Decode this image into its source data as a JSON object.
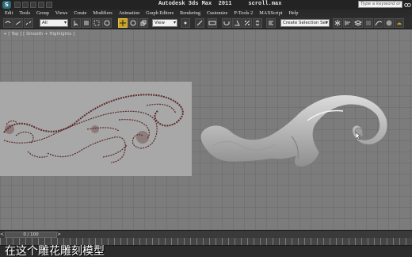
{
  "titlebar": {
    "title": "Autodesk 3ds Max  2011     scroll.max",
    "search_placeholder": "Type a keyword or phrase"
  },
  "menus": [
    "Edit",
    "Tools",
    "Group",
    "Views",
    "Create",
    "Modifiers",
    "Animation",
    "Graph Editors",
    "Rendering",
    "Customize",
    "P-Tools 2",
    "MAXScript",
    "Help"
  ],
  "toolbar": {
    "selection_filter": "All",
    "reference_coord": "View",
    "named_selection_set": "Create Selection Set"
  },
  "viewport": {
    "label": "+ [ Top ] [ Smooth + Highlights ]",
    "ref_stroke_color": "#5a2a2a",
    "model_color": "#cfcfcf"
  },
  "timeline": {
    "frame_counter": "0 / 100",
    "prev_label": "<",
    "next_label": ">"
  },
  "subtitle": "在这个雕花雕刻模型"
}
